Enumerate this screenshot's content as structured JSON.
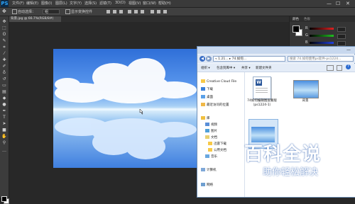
{
  "app": {
    "logo": "PS"
  },
  "menubar": {
    "items": [
      "文件(F)",
      "编辑(E)",
      "图像(I)",
      "图层(L)",
      "文字(Y)",
      "选择(S)",
      "滤镜(T)",
      "3D(D)",
      "视图(V)",
      "窗口(W)",
      "帮助(H)"
    ]
  },
  "window_controls": {
    "minimize": "—",
    "maximize": "☐",
    "close": "✕"
  },
  "options_bar": {
    "auto_select": "自动选择：",
    "auto_select_value": "组",
    "show_transform": "显示变换控件"
  },
  "document_tab": {
    "label": "背景.jpg @ 66.7%(RGB/8#)",
    "close": "×"
  },
  "color_panel": {
    "tabs": [
      "颜色",
      "色板"
    ],
    "sliders": [
      {
        "label": "R",
        "color": "#e02020"
      },
      {
        "label": "G",
        "color": "#20c020"
      },
      {
        "label": "B",
        "color": "#2040e0"
      }
    ]
  },
  "explorer": {
    "breadcrumb": "« 1.21... ▸ 74.如何...",
    "search_placeholder": "搜索 74.如何使用ps软件-ps1224...",
    "commands": [
      "组织 ▾",
      "包含到库中 ▾",
      "共享 ▾",
      "新建文件夹"
    ],
    "nav": {
      "favorites": [
        "Creative Cloud File",
        "下载",
        "桌面",
        "最近访问的位置"
      ],
      "libraries": [
        "库",
        "视频",
        "图片",
        "文档",
        "迅雷下载",
        "公用文档",
        "音乐"
      ],
      "computer": [
        "计算机"
      ],
      "network": [
        "网络"
      ]
    },
    "files": [
      {
        "name": "74如何编辑图层蒙版（ps1224-1）",
        "type": "document"
      },
      {
        "name": "背景",
        "type": "image"
      }
    ]
  },
  "watermark": {
    "title": "百科全说",
    "subtitle": "助你轻松解决"
  }
}
